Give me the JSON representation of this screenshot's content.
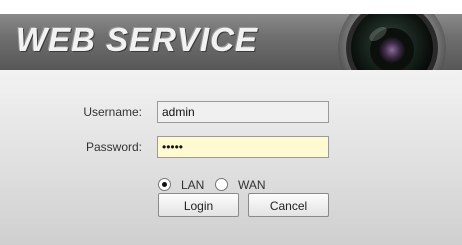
{
  "banner": {
    "title": "WEB SERVICE",
    "camera_icon": "camera-lens-icon"
  },
  "login_form": {
    "username": {
      "label": "Username:",
      "value": "admin"
    },
    "password": {
      "label": "Password:",
      "value": "admin"
    },
    "network_mode": {
      "options": [
        "LAN",
        "WAN"
      ],
      "selected": "LAN"
    },
    "login_label": "Login",
    "cancel_label": "Cancel"
  },
  "colors": {
    "banner_bg": "#6f6f6f",
    "password_field_bg": "#fffad2",
    "panel_bg": "#dedede"
  }
}
